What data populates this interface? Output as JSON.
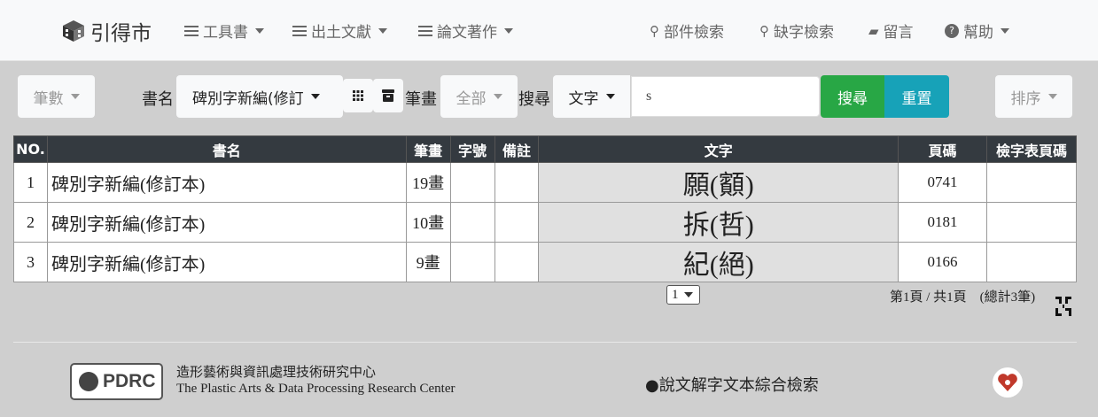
{
  "nav": {
    "brand": "引得市",
    "menus": [
      "工具書",
      "出土文獻",
      "論文著作"
    ],
    "right": [
      {
        "icon": "search-icon",
        "label": "部件檢索"
      },
      {
        "icon": "search-missing-icon",
        "label": "缺字檢索"
      },
      {
        "icon": "message-icon",
        "label": "留言"
      },
      {
        "icon": "help-icon",
        "label": "幫助"
      }
    ]
  },
  "toolbar": {
    "count_label": "筆數",
    "book_label": "書名",
    "book_value": "碑別字新編(修訂",
    "stroke_label": "筆畫",
    "stroke_value": "全部",
    "search_label": "搜尋",
    "search_type": "文字",
    "search_value": "s",
    "search_button": "搜尋",
    "reset_button": "重置",
    "sort_label": "排序"
  },
  "table": {
    "headers": [
      "NO.",
      "書名",
      "筆畫",
      "字號",
      "備註",
      "文字",
      "頁碼",
      "檢字表頁碼"
    ],
    "rows": [
      {
        "no": "1",
        "book": "碑別字新編(修訂本)",
        "strokes": "19畫",
        "num": "",
        "note": "",
        "text": "願(顮)",
        "page": "0741",
        "index_page": ""
      },
      {
        "no": "2",
        "book": "碑別字新編(修訂本)",
        "strokes": "10畫",
        "num": "",
        "note": "",
        "text": "拆(哲)",
        "page": "0181",
        "index_page": ""
      },
      {
        "no": "3",
        "book": "碑別字新編(修訂本)",
        "strokes": "9畫",
        "num": "",
        "note": "",
        "text": "紀(絕)",
        "page": "0166",
        "index_page": ""
      }
    ]
  },
  "pagination": {
    "current": "1",
    "info": "第1頁 / 共1頁　(總計3筆)"
  },
  "footer": {
    "logo_text": "PDRC",
    "org_zh": "造形藝術與資訊處理技術研究中心",
    "org_en": "The Plastic Arts & Data Processing Research Center",
    "site": "●說文解字文本綜合檢索"
  }
}
